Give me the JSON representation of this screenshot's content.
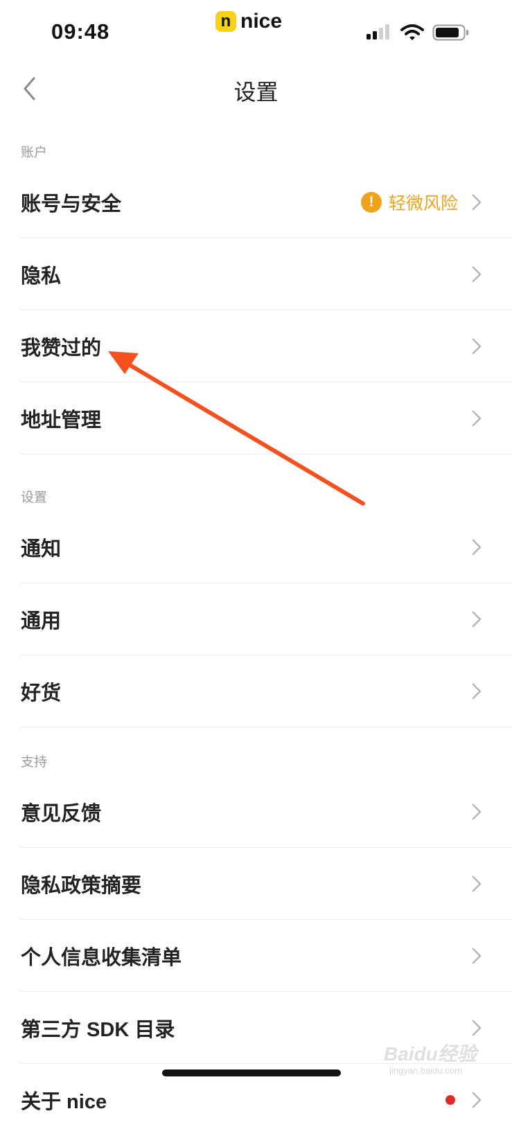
{
  "status_bar": {
    "time": "09:48",
    "app_logo_badge": "n",
    "app_logo_text": "nice",
    "icons": [
      "signal-icon",
      "wifi-icon",
      "battery-icon"
    ]
  },
  "nav": {
    "title": "设置",
    "back_icon": "chevron-left-icon"
  },
  "colors": {
    "risk_accent": "#f0a21c",
    "annotation_arrow": "#f4511e",
    "notification_dot": "#e02a2a",
    "logo_badge": "#f7d21c"
  },
  "sections": [
    {
      "title": "账户",
      "items": [
        {
          "label": "账号与安全",
          "badge_text": "轻微风险",
          "badge_icon": "exclamation-icon"
        },
        {
          "label": "隐私"
        },
        {
          "label": "我赞过的"
        },
        {
          "label": "地址管理"
        }
      ]
    },
    {
      "title": "设置",
      "items": [
        {
          "label": "通知"
        },
        {
          "label": "通用"
        },
        {
          "label": "好货"
        }
      ]
    },
    {
      "title": "支持",
      "items": [
        {
          "label": "意见反馈"
        },
        {
          "label": "隐私政策摘要"
        },
        {
          "label": "个人信息收集清单"
        },
        {
          "label": "第三方 SDK 目录"
        },
        {
          "label": "关于 nice"
        }
      ]
    }
  ],
  "watermark": {
    "main": "Baidu经验",
    "sub": "jingyan.baidu.com"
  }
}
